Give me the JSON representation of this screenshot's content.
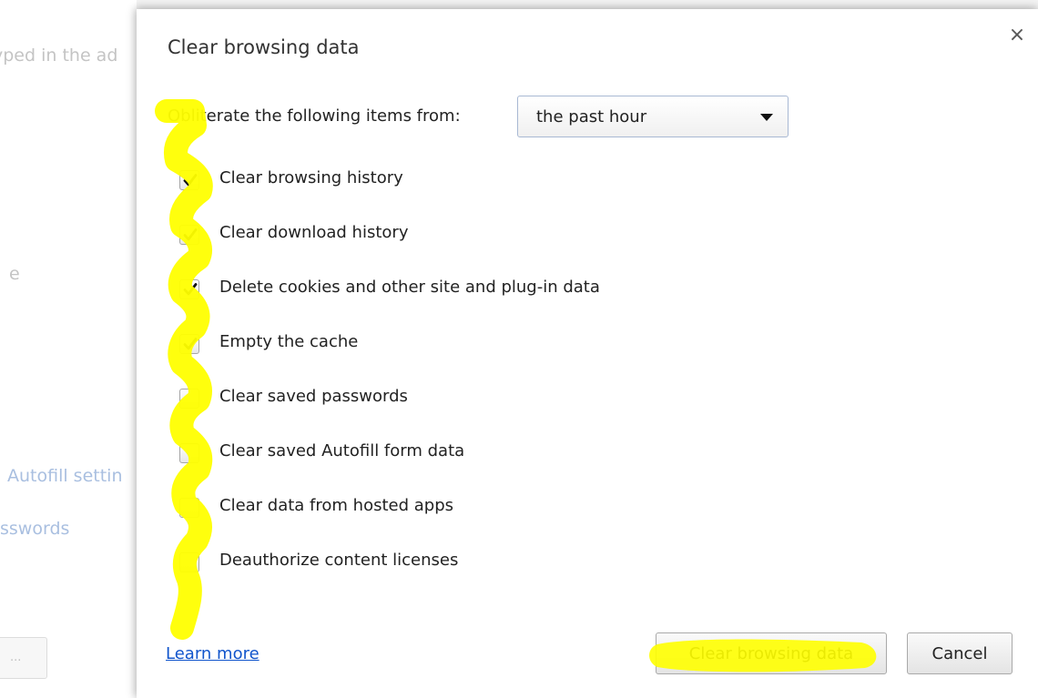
{
  "background_page": {
    "text_1": "yped in the ad",
    "text_2": "e",
    "text_3": "Autofill settin",
    "text_4": "sswords",
    "button_label": "..."
  },
  "dialog": {
    "title": "Clear browsing data",
    "close_glyph": "×",
    "from_label": "Obliterate the following items from:",
    "time_range": {
      "selected": "the past hour"
    },
    "options": [
      {
        "label": "Clear browsing history",
        "checked": true
      },
      {
        "label": "Clear download history",
        "checked": true
      },
      {
        "label": "Delete cookies and other site and plug-in data",
        "checked": true
      },
      {
        "label": "Empty the cache",
        "checked": true
      },
      {
        "label": "Clear saved passwords",
        "checked": false
      },
      {
        "label": "Clear saved Autofill form data",
        "checked": false
      },
      {
        "label": "Clear data from hosted apps",
        "checked": false
      },
      {
        "label": "Deauthorize content licenses",
        "checked": false
      }
    ],
    "learn_more": "Learn more",
    "clear_button": "Clear browsing data",
    "cancel_button": "Cancel"
  },
  "colors": {
    "highlighter": "#ffff00",
    "link": "#1155cc"
  }
}
